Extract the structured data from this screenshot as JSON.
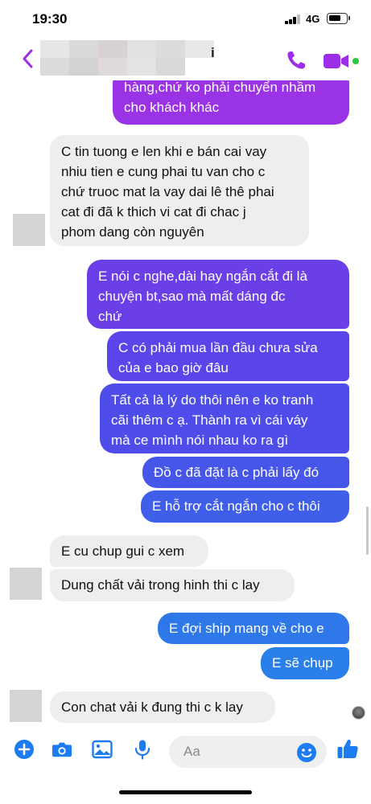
{
  "status_bar": {
    "time": "19:30",
    "network": "4G"
  },
  "header": {
    "contact_name_partial": "i"
  },
  "messages": [
    {
      "side": "out",
      "lines": [
        "hàng,chứ ko phải chuyển nhầm",
        "cho khách khác"
      ],
      "color": "#9a32e6"
    },
    {
      "side": "in",
      "lines": [
        "C tin tuong e len khi e bán cai vay",
        "nhiu tien e cung phai tu van cho c",
        "chứ truoc mat la vay dai lê thê phai",
        "cat đi đã k thich vi cat đi chac j",
        "phom dang còn nguyên"
      ]
    },
    {
      "side": "out",
      "lines": [
        "E nói c nghe,dài hay ngắn cắt đi là",
        "chuyện bt,sao mà mất dáng đc",
        "chứ"
      ],
      "color": "#6b3fe8"
    },
    {
      "side": "out",
      "lines": [
        "C có phải mua lần đầu chưa sửa",
        "của e bao giờ đâu"
      ],
      "color": "#5a44ea"
    },
    {
      "side": "out",
      "lines": [
        "Tất cả là lý do thôi nên e ko tranh",
        "cãi thêm c ạ. Thành ra vì cái váy",
        "mà ce mình nói nhau ko ra gì"
      ],
      "color": "#4f4de9"
    },
    {
      "side": "out",
      "lines": [
        "Đồ c đã đặt là c phải lấy đó"
      ],
      "color": "#4656e9"
    },
    {
      "side": "out",
      "lines": [
        "E hỗ trợ cắt ngắn cho c thôi"
      ],
      "color": "#3f5ee9"
    },
    {
      "side": "in",
      "lines": [
        "E cu chup gui c xem"
      ]
    },
    {
      "side": "in",
      "lines": [
        "Dung chất vải trong hinh thi c lay"
      ]
    },
    {
      "side": "out",
      "lines": [
        "E đợi ship mang về cho e"
      ],
      "color": "#2f78ea"
    },
    {
      "side": "out",
      "lines": [
        "E sẽ chụp"
      ],
      "color": "#2a7fea"
    },
    {
      "side": "in",
      "lines": [
        "Con chat vải k đung thi c k lay"
      ]
    }
  ],
  "composer": {
    "placeholder": "Aa"
  },
  "colors": {
    "accent": "#9b2ee6",
    "action_blue": "#1e7cf2",
    "in_bubble": "#eeeeee"
  },
  "icons": [
    "back-chevron-icon",
    "phone-icon",
    "video-camera-icon",
    "plus-icon",
    "camera-icon",
    "gallery-icon",
    "microphone-icon",
    "emoji-icon",
    "thumbs-up-icon"
  ]
}
